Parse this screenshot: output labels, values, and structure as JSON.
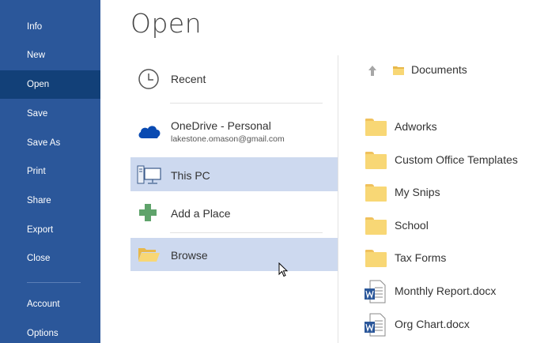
{
  "nav": {
    "items": [
      {
        "label": "Info"
      },
      {
        "label": "New"
      },
      {
        "label": "Open"
      },
      {
        "label": "Save"
      },
      {
        "label": "Save As"
      },
      {
        "label": "Print"
      },
      {
        "label": "Share"
      },
      {
        "label": "Export"
      },
      {
        "label": "Close"
      },
      {
        "label": "Account"
      },
      {
        "label": "Options"
      }
    ],
    "selected": "Open"
  },
  "page": {
    "title": "Open"
  },
  "places": {
    "recent": {
      "label": "Recent",
      "icon": "clock-icon"
    },
    "onedrive": {
      "label": "OneDrive - Personal",
      "account": "lakestone.omason@gmail.com",
      "icon": "cloud-icon"
    },
    "this_pc": {
      "label": "This PC",
      "icon": "computer-icon",
      "selected": true
    },
    "add_place": {
      "label": "Add a Place",
      "icon": "plus-icon"
    },
    "browse": {
      "label": "Browse",
      "icon": "open-folder-icon",
      "hovered": true
    }
  },
  "location": {
    "breadcrumb": "Documents",
    "up_icon": "up-arrow-icon"
  },
  "items": [
    {
      "name": "Adworks",
      "type": "folder"
    },
    {
      "name": "Custom Office Templates",
      "type": "folder"
    },
    {
      "name": "My Snips",
      "type": "folder"
    },
    {
      "name": "School",
      "type": "folder"
    },
    {
      "name": "Tax Forms",
      "type": "folder"
    },
    {
      "name": "Monthly Report.docx",
      "type": "word"
    },
    {
      "name": "Org Chart.docx",
      "type": "word"
    }
  ],
  "colors": {
    "nav_bg": "#2b579a",
    "nav_selected": "#124078",
    "place_selected": "#cdd9ef",
    "folder": "#f8d775",
    "word_blue": "#2b579a"
  }
}
